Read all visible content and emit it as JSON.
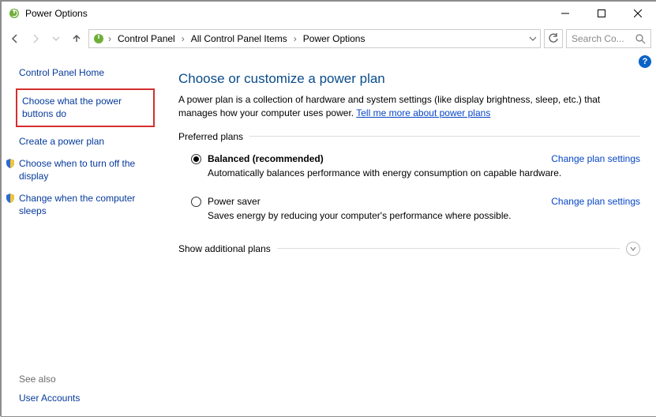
{
  "window": {
    "title": "Power Options"
  },
  "breadcrumb": {
    "items": [
      "Control Panel",
      "All Control Panel Items",
      "Power Options"
    ]
  },
  "search": {
    "placeholder": "Search Co..."
  },
  "sidebar": {
    "home": "Control Panel Home",
    "links": [
      "Choose what the power buttons do",
      "Create a power plan",
      "Choose when to turn off the display",
      "Change when the computer sleeps"
    ]
  },
  "see_also": {
    "header": "See also",
    "link": "User Accounts"
  },
  "main": {
    "title": "Choose or customize a power plan",
    "intro_pre": "A power plan is a collection of hardware and system settings (like display brightness, sleep, etc.) that manages how your computer uses power. ",
    "intro_link": "Tell me more about power plans",
    "preferred_header": "Preferred plans",
    "plans": [
      {
        "name": "Balanced (recommended)",
        "desc": "Automatically balances performance with energy consumption on capable hardware.",
        "change": "Change plan settings",
        "checked": true
      },
      {
        "name": "Power saver",
        "desc": "Saves energy by reducing your computer's performance where possible.",
        "change": "Change plan settings",
        "checked": false
      }
    ],
    "expander": "Show additional plans"
  }
}
